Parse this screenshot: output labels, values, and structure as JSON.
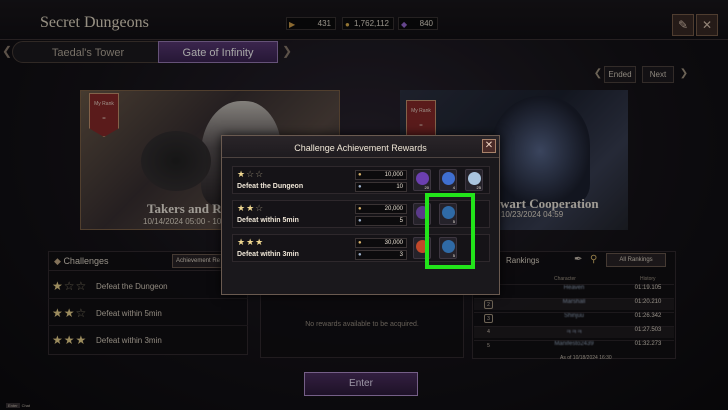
{
  "header": {
    "title": "Secret Dungeons",
    "tabs": [
      {
        "label": "Taedal's Tower",
        "active": false
      },
      {
        "label": "Gate of Infinity",
        "active": true
      }
    ],
    "resources": [
      {
        "icon": "ticket-icon",
        "value": "431"
      },
      {
        "icon": "gold-coin-icon",
        "value": "1,762,112"
      },
      {
        "icon": "purple-crystal-icon",
        "value": "840"
      }
    ],
    "nav": {
      "ended_label": "Ended",
      "next_label": "Next"
    }
  },
  "cards": [
    {
      "rank_label": "My Rank",
      "rank_value": "-",
      "title": "Takers and R",
      "date": "10/14/2024 05:00 - 10"
    },
    {
      "rank_label": "My Rank",
      "rank_value": "-",
      "title": "wart Cooperation",
      "date": "- 10/23/2024 04:59"
    }
  ],
  "challenges": {
    "title": "Challenges",
    "achievement_button": "Achievement Re",
    "rows": [
      {
        "stars": 1,
        "label": "Defeat the Dungeon"
      },
      {
        "stars": 2,
        "label": "Defeat within 5min"
      },
      {
        "stars": 3,
        "label": "Defeat within 3min"
      }
    ]
  },
  "rewards_empty_text": "No rewards available to be acquired.",
  "rankings": {
    "title": "Rankings",
    "all_button": "All Rankings",
    "col_character": "Character",
    "col_history": "History",
    "rows": [
      {
        "rank": "1",
        "name": "Heaven",
        "time": "01:19.105"
      },
      {
        "rank": "2",
        "name": "Marshall",
        "time": "01:20.210"
      },
      {
        "rank": "3",
        "name": "Shinjuu",
        "time": "01:26.342"
      },
      {
        "rank": "4",
        "name": "ㅋㅋㅋ",
        "time": "01:27.503"
      },
      {
        "rank": "5",
        "name": "Manifesto2439",
        "time": "01:32.273"
      }
    ],
    "as_of": "As of 10/18/2024 16:30"
  },
  "enter_button": "Enter",
  "chat": {
    "key": "Enter",
    "label": "Chat"
  },
  "modal": {
    "title": "Challenge Achievement Rewards",
    "close_icon": "close-icon",
    "rows": [
      {
        "stars": 1,
        "label": "Defeat the Dungeon",
        "gold": "10,000",
        "second": "10",
        "items": [
          {
            "icon": "purple-crystal-icon",
            "count": "20",
            "color": "#6b3fb0"
          },
          {
            "icon": "blue-crystal-icon",
            "count": "4",
            "color": "#3f6fd0"
          },
          {
            "icon": "white-orb-icon",
            "count": "25",
            "color": "#a9c4de"
          }
        ]
      },
      {
        "stars": 2,
        "label": "Defeat within 5min",
        "gold": "20,000",
        "second": "5",
        "items": [
          {
            "icon": "purple-gem-icon",
            "count": "",
            "color": "#5a3a8a"
          },
          {
            "icon": "blue-orb-icon",
            "count": "5",
            "color": "#2f6aa6"
          }
        ]
      },
      {
        "stars": 3,
        "label": "Defeat within 3min",
        "gold": "30,000",
        "second": "3",
        "items": [
          {
            "icon": "red-orb-icon",
            "count": "",
            "color": "#c0482a"
          },
          {
            "icon": "blue-orb-icon",
            "count": "5",
            "color": "#2f6aa6"
          }
        ]
      }
    ]
  },
  "colors": {
    "accent_purple": "#5a3a77",
    "highlight_green": "#22e41a",
    "star_gold": "#f0d891"
  }
}
